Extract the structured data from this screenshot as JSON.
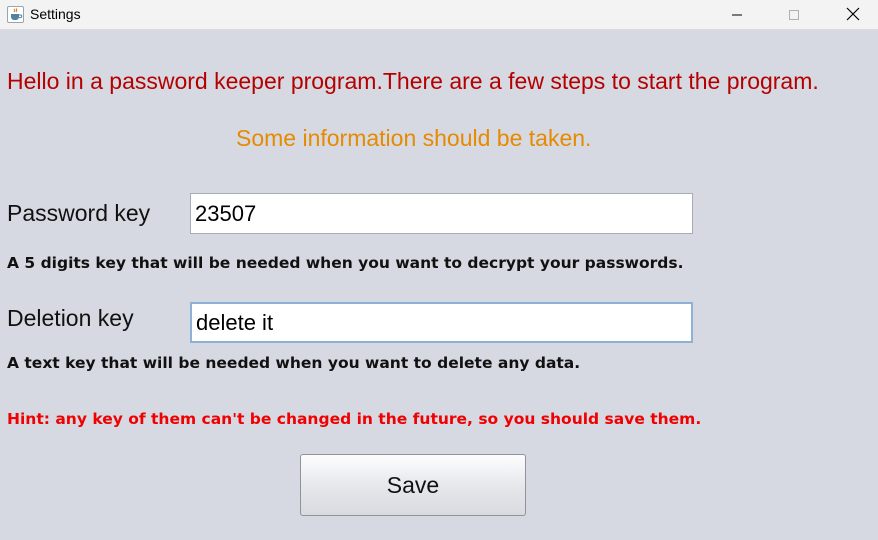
{
  "window": {
    "title": "Settings",
    "controls": {
      "minimize_glyph": "—",
      "maximize_glyph": "☐",
      "close_glyph": "✕"
    }
  },
  "content": {
    "heading": "Hello in a password keeper program.There are a few steps to start the program.",
    "subheading": "Some information should be taken.",
    "password_key": {
      "label": "Password key",
      "value": "23507",
      "description": "A 5 digits key that will be needed when you want to decrypt your passwords."
    },
    "deletion_key": {
      "label": "Deletion key",
      "value": "delete it",
      "description": "A text key that will be needed when you want to delete any data."
    },
    "hint": "Hint: any key of them can't be changed in the future, so you should save them.",
    "save_label": "Save"
  },
  "colors": {
    "heading": "#b50000",
    "subheading": "#e68a00",
    "hint": "#f00000",
    "background": "#d6d9e1",
    "focus_border": "#8fb1d6"
  },
  "icons": {
    "app": "java-coffee-cup-icon",
    "minimize": "minimize-icon",
    "maximize": "maximize-icon",
    "close": "close-icon"
  }
}
